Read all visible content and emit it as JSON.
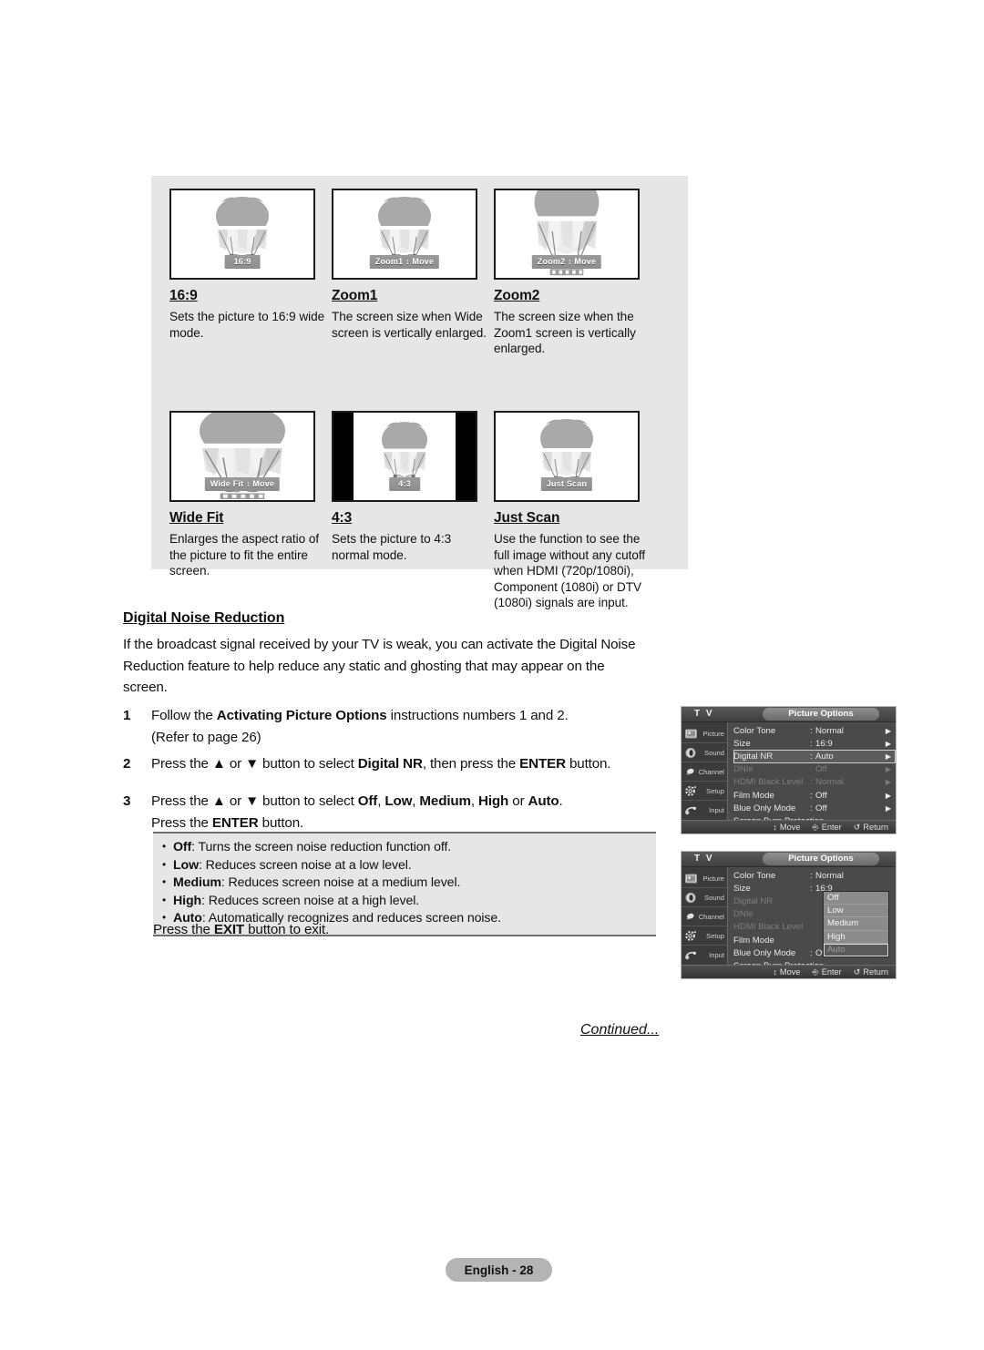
{
  "aspect_panel": {
    "items": [
      {
        "title": "16:9",
        "osd_label": "16:9",
        "description": "Sets the picture to 16:9 wide mode.",
        "style": "plain"
      },
      {
        "title": "Zoom1",
        "osd_label": "Zoom1 ↕ Move",
        "description": "The screen size when Wide screen is vertically enlarged.",
        "style": "plain"
      },
      {
        "title": "Zoom2",
        "osd_label": "Zoom2 ↕ Move",
        "description": "The screen size when the Zoom1 screen is vertically enlarged.",
        "style": "cropped"
      },
      {
        "title": "Wide Fit",
        "osd_label": "Wide Fit ↕ Move",
        "description": "Enlarges the aspect ratio of the picture to fit the entire screen.",
        "style": "wide"
      },
      {
        "title": "4:3",
        "osd_label": "4:3",
        "description": "Sets the picture to 4:3 normal mode.",
        "style": "pillarbox"
      },
      {
        "title": "Just Scan",
        "osd_label": "Just Scan",
        "description": "Use the function to see the full image without any cutoff when HDMI (720p/1080i), Component (1080i) or DTV (1080i) signals are input.",
        "style": "plain"
      }
    ]
  },
  "section": {
    "heading": "Digital Noise Reduction",
    "intro": "If the broadcast signal received by your TV is weak, you can activate the Digital Noise Reduction feature to help reduce any static and ghosting that may appear on the screen.",
    "steps": [
      {
        "number": "1",
        "parts": [
          {
            "t": "Follow the ",
            "b": false
          },
          {
            "t": "Activating Picture Options",
            "b": true
          },
          {
            "t": " instructions numbers 1 and 2.",
            "b": false
          },
          {
            "t": "\n(Refer to page 26)",
            "b": false
          }
        ]
      },
      {
        "number": "2",
        "parts": [
          {
            "t": "Press the ▲ or ▼ button to select ",
            "b": false
          },
          {
            "t": "Digital NR",
            "b": true
          },
          {
            "t": ", then press the ",
            "b": false
          },
          {
            "t": "ENTER",
            "b": true
          },
          {
            "t": " button.",
            "b": false
          }
        ]
      },
      {
        "number": "3",
        "parts": [
          {
            "t": "Press the ▲ or ▼ button to select ",
            "b": false
          },
          {
            "t": "Off",
            "b": true
          },
          {
            "t": ", ",
            "b": false
          },
          {
            "t": "Low",
            "b": true
          },
          {
            "t": ", ",
            "b": false
          },
          {
            "t": "Medium",
            "b": true
          },
          {
            "t": ", ",
            "b": false
          },
          {
            "t": "High",
            "b": true
          },
          {
            "t": " or ",
            "b": false
          },
          {
            "t": "Auto",
            "b": true
          },
          {
            "t": ".\nPress the ",
            "b": false
          },
          {
            "t": "ENTER",
            "b": true
          },
          {
            "t": " button.",
            "b": false
          }
        ]
      }
    ],
    "options": [
      {
        "name": "Off",
        "text": ": Turns the screen noise reduction function off."
      },
      {
        "name": "Low",
        "text": ": Reduces screen noise at a low level."
      },
      {
        "name": "Medium",
        "text": ": Reduces screen noise at a medium level."
      },
      {
        "name": "High",
        "text": ": Reduces screen noise at a high level."
      },
      {
        "name": "Auto",
        "text": ": Automatically recognizes and reduces screen noise."
      }
    ],
    "exit_line_parts": [
      {
        "t": "Press the ",
        "b": false
      },
      {
        "t": "EXIT",
        "b": true
      },
      {
        "t": " button to exit.",
        "b": false
      }
    ],
    "continued": "Continued..."
  },
  "footer": {
    "page_label": "English - 28"
  },
  "osd": {
    "tv_label": "T V",
    "title": "Picture Options",
    "sidebar": [
      {
        "label": "Picture",
        "icon": "picture-icon"
      },
      {
        "label": "Sound",
        "icon": "sound-icon"
      },
      {
        "label": "Channel",
        "icon": "channel-icon"
      },
      {
        "label": "Setup",
        "icon": "setup-icon"
      },
      {
        "label": "Input",
        "icon": "input-icon"
      }
    ],
    "bottom_bar": [
      {
        "key": "↕",
        "label": "Move"
      },
      {
        "key": "⎆",
        "label": "Enter"
      },
      {
        "key": "↺",
        "label": "Return"
      }
    ],
    "screen1": {
      "rows": [
        {
          "label": "Color Tone",
          "value": "Normal",
          "dim": false,
          "arrow": true,
          "selected": false
        },
        {
          "label": "Size",
          "value": "16:9",
          "dim": false,
          "arrow": true,
          "selected": false
        },
        {
          "label": "Digital NR",
          "value": "Auto",
          "dim": false,
          "arrow": true,
          "selected": true
        },
        {
          "label": "DNIe",
          "value": "Off",
          "dim": true,
          "arrow": true,
          "selected": false
        },
        {
          "label": "HDMI Black Level",
          "value": "Normal",
          "dim": true,
          "arrow": true,
          "selected": false
        },
        {
          "label": "Film Mode",
          "value": "Off",
          "dim": false,
          "arrow": true,
          "selected": false
        },
        {
          "label": "Blue Only Mode",
          "value": "Off",
          "dim": false,
          "arrow": true,
          "selected": false
        },
        {
          "label": "Screen Burn Protection",
          "value": "",
          "dim": false,
          "arrow": false,
          "selected": false
        }
      ]
    },
    "screen2": {
      "rows": [
        {
          "label": "Color Tone",
          "value": "Normal",
          "dim": false,
          "arrow": false,
          "selected": false
        },
        {
          "label": "Size",
          "value": "16:9",
          "dim": false,
          "arrow": false,
          "selected": false
        },
        {
          "label": "Digital NR",
          "value": "",
          "dim": true,
          "arrow": false,
          "selected": false
        },
        {
          "label": "DNIe",
          "value": "",
          "dim": true,
          "arrow": false,
          "selected": false
        },
        {
          "label": "HDMI Black Level",
          "value": "",
          "dim": true,
          "arrow": false,
          "selected": false
        },
        {
          "label": "Film Mode",
          "value": "",
          "dim": false,
          "arrow": false,
          "selected": false
        },
        {
          "label": "Blue Only Mode",
          "value": "Off",
          "dim": false,
          "arrow": false,
          "selected": false
        },
        {
          "label": "Screen Burn Protection",
          "value": "",
          "dim": false,
          "arrow": false,
          "selected": false
        }
      ],
      "dropdown": {
        "options": [
          "Off",
          "Low",
          "Medium",
          "High",
          "Auto"
        ],
        "selected": "Auto"
      }
    }
  },
  "colors": {
    "panel_bg": "#e6e6e6",
    "osd_bg": "#4a4a4a",
    "osd_highlight": "#5c5c5c",
    "footer_pill": "#b4b4b4"
  }
}
